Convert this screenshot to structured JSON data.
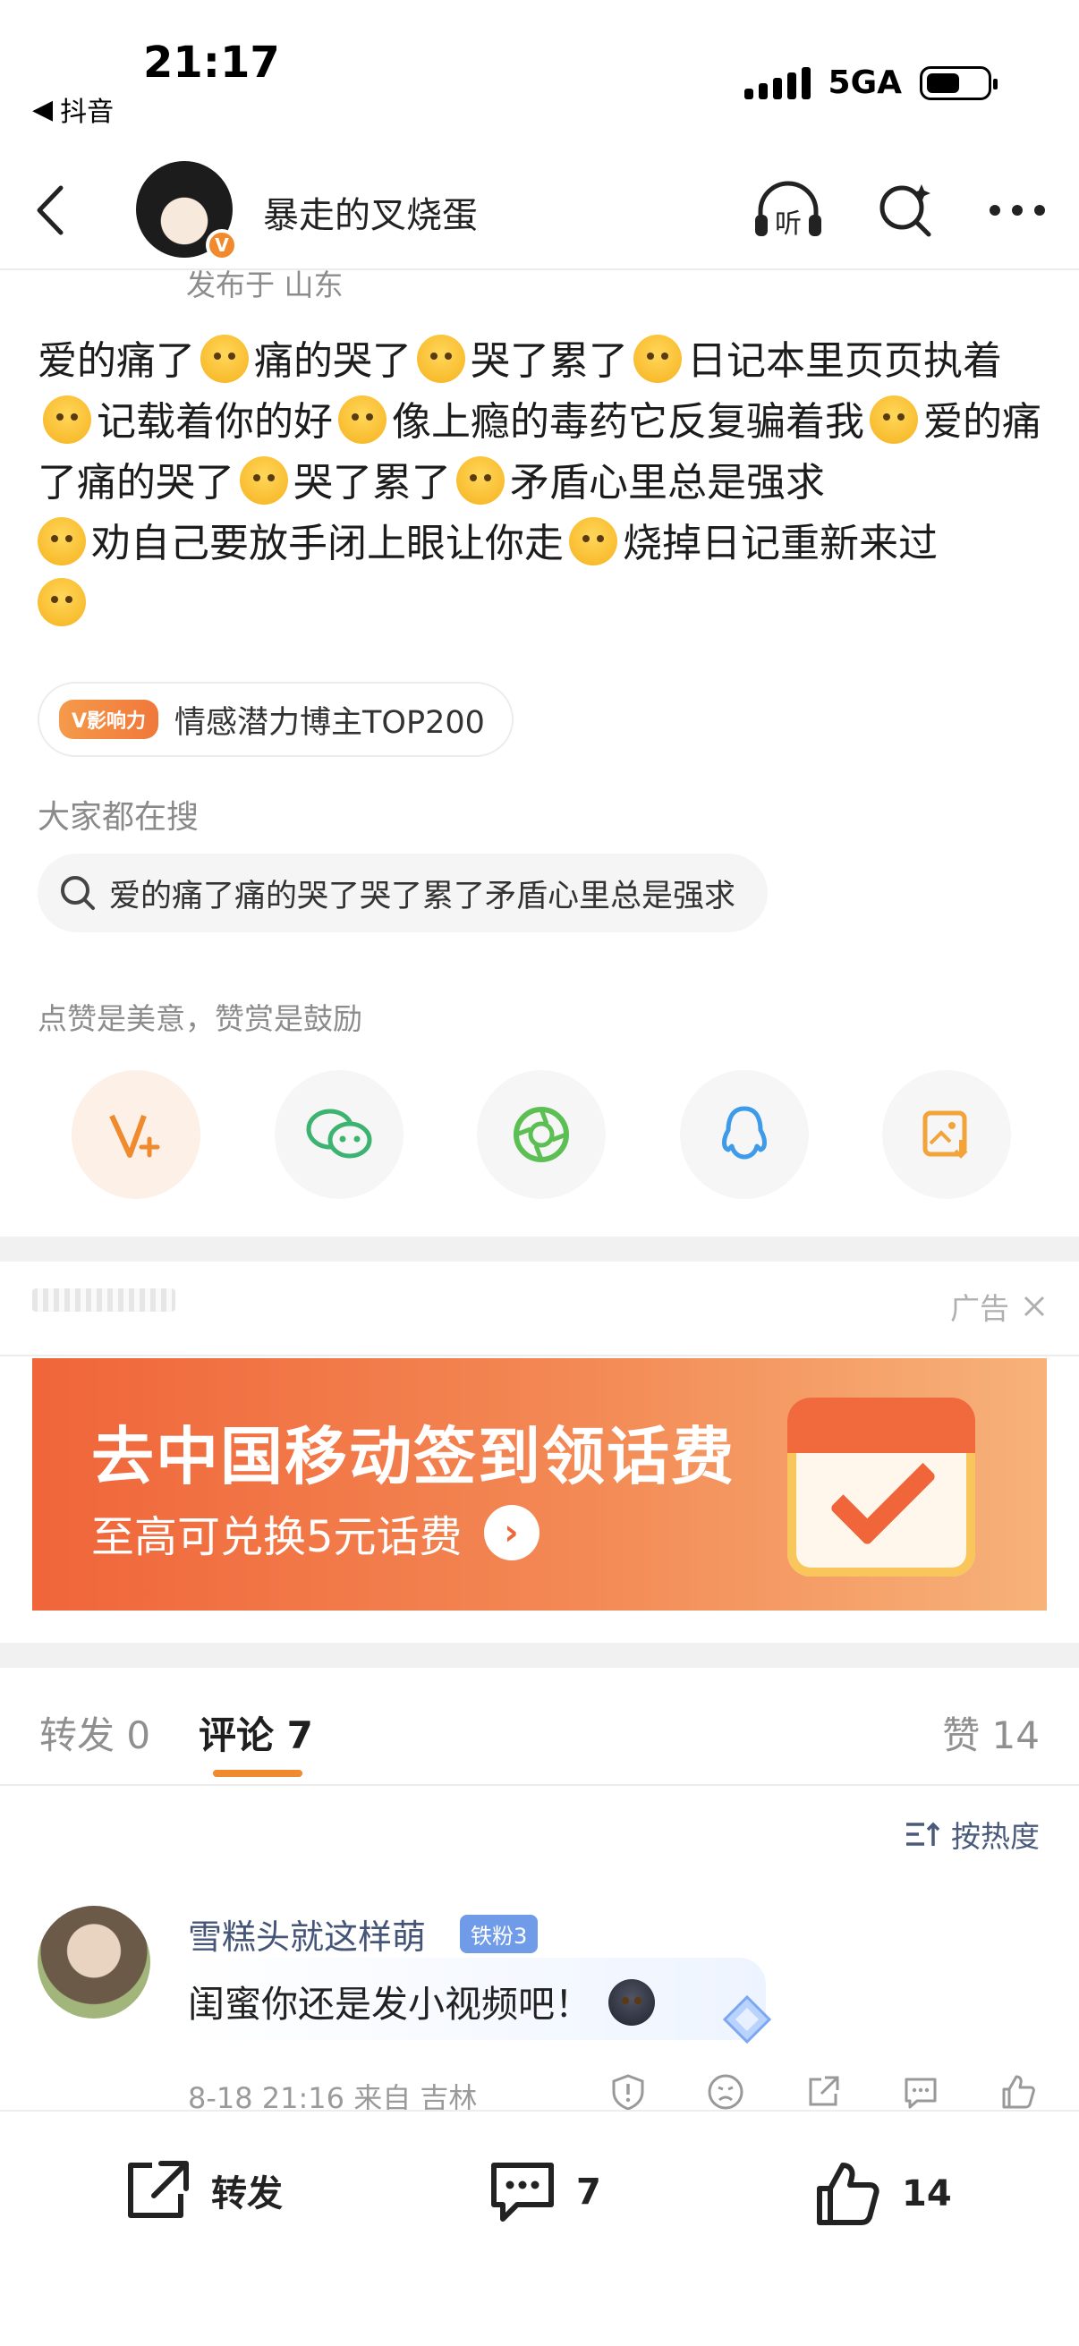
{
  "status_bar": {
    "time": "21:17",
    "back_app": "抖音",
    "network": "5GA"
  },
  "header": {
    "title": "暴走的叉烧蛋",
    "vip_badge": "V"
  },
  "post": {
    "location_line": "发布于 山东",
    "content": [
      "爱的痛了",
      {
        "emoji": "bandage-face"
      },
      "痛的哭了",
      {
        "emoji": "loudly-crying"
      },
      "哭了累了",
      {
        "emoji": "crying"
      },
      "日记本里页页执着",
      {
        "emoji": "pensive"
      },
      "记载着你的好",
      {
        "emoji": "smile"
      },
      "像上瘾的毒药它反复骗着我",
      {
        "emoji": "pensive"
      },
      "爱的痛了痛的哭了",
      {
        "emoji": "loudly-crying"
      },
      "哭了累了",
      {
        "emoji": "crying"
      },
      "矛盾心里总是强求",
      {
        "emoji": "pleading"
      },
      "劝自己要放手闭上眼让你走",
      {
        "emoji": "tired"
      },
      "烧掉日记重新来过",
      {
        "emoji": "winking-tongue"
      }
    ],
    "influence_tag": "V影响力",
    "influence_text": "情感潜力博主TOP200",
    "search_label": "大家都在搜",
    "search_query": "爱的痛了痛的哭了哭了累了矛盾心里总是强求",
    "praise_label": "点赞是美意，赞赏是鼓励"
  },
  "ad": {
    "tag": "广告",
    "title": "去中国移动签到领话费",
    "subtitle": "至高可兑换5元话费"
  },
  "tabs": {
    "repost": "转发 0",
    "comment": "评论 7",
    "like": "赞 14",
    "sort": "按热度"
  },
  "comment": {
    "name": "雪糕头就这样萌",
    "badge": "铁粉3",
    "text": "闺蜜你还是发小视频吧！",
    "meta": "8-18 21:16  来自 吉林"
  },
  "bottom_bar": {
    "repost": "转发",
    "comment_count": "7",
    "like_count": "14"
  },
  "colors": {
    "accent": "#f08a2e",
    "ad_orange": "#f0653a",
    "link_blue": "#445577"
  }
}
